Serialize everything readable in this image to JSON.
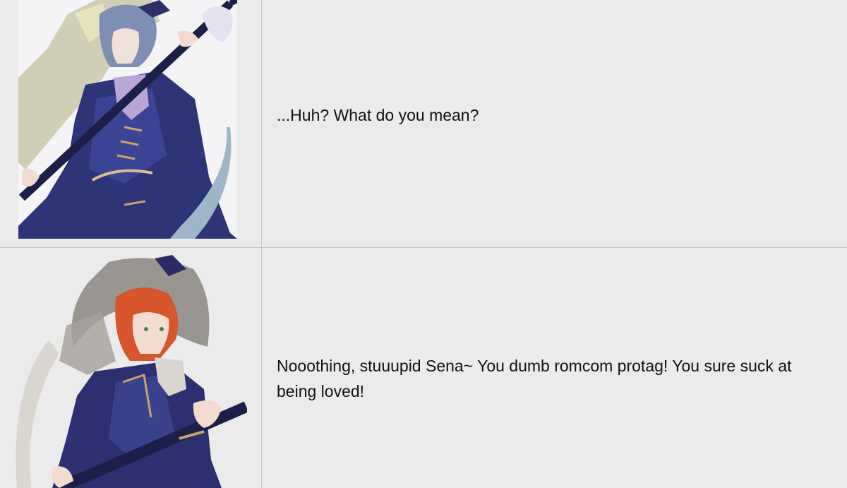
{
  "rows": [
    {
      "portrait": "character-portrait-blue-haired",
      "line": "...Huh? What do you mean?"
    },
    {
      "portrait": "character-portrait-orange-haired",
      "line": "Nooothing, stuuupid Sena~ You dumb romcom protag! You sure suck at being loved!"
    }
  ],
  "colors": {
    "background": "#ebebeb",
    "border": "#c4c4c4",
    "text": "#111111"
  }
}
